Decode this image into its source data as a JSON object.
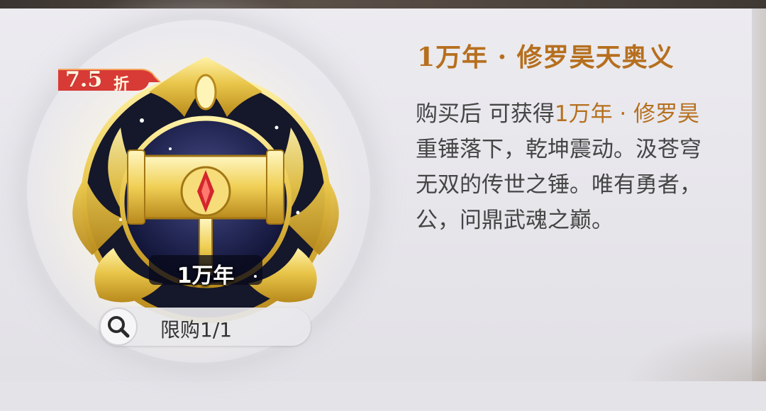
{
  "discount": {
    "value": "7.5",
    "unit": "折"
  },
  "item": {
    "emblem_label": "1万年",
    "title": "1万年 · 修罗昊天奥义"
  },
  "purchase_limit": {
    "label": "限购1/1"
  },
  "description": {
    "line1_prefix": "购买后 可获得",
    "line1_highlight": "1万年 · 修罗昊",
    "line2": "重锤落下，乾坤震动。汲苍穹",
    "line3": "无双的传世之锤。唯有勇者，",
    "line4": "公，问鼎武魂之巅。"
  },
  "colors": {
    "title": "#b66f1e",
    "highlight": "#b6701f",
    "badge_red": "#d83a35",
    "gold": "#e9c64a",
    "orb_navy": "#252a58"
  },
  "icons": {
    "search": "magnifier-icon",
    "emblem": "golden-hammer-emblem"
  }
}
